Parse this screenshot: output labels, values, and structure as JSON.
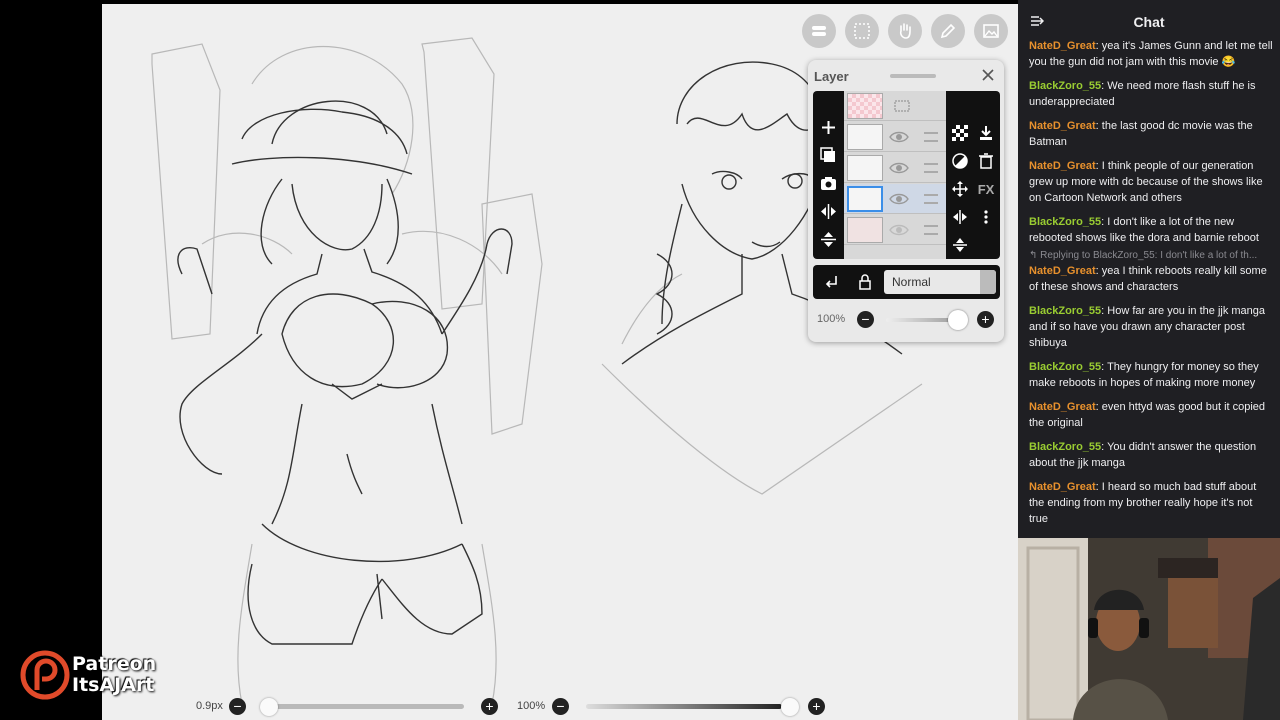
{
  "top_tools": [
    {
      "name": "toggle-tool",
      "icon": "toggle-icon"
    },
    {
      "name": "selection-tool",
      "icon": "selection-icon"
    },
    {
      "name": "hand-tool",
      "icon": "hand-icon"
    },
    {
      "name": "pen-tool",
      "icon": "pen-icon"
    },
    {
      "name": "image-tool",
      "icon": "image-icon"
    }
  ],
  "layer_panel": {
    "title": "Layer",
    "blend_mode": "Normal",
    "opacity": "100%"
  },
  "bottom_bar": {
    "brush_size": "0.9px",
    "brush_opacity": "100%"
  },
  "patreon": {
    "line1": "Patreon",
    "line2": "ItsAJArt"
  },
  "chat": {
    "title": "Chat",
    "user_colors": {
      "NateD_Great": "#e8912d",
      "BlackZoro_55": "#9acd32"
    },
    "messages": [
      {
        "user": "NateD_Great",
        "text": "yea it's James Gunn and let me tell you the gun did not jam with this movie 😂"
      },
      {
        "user": "BlackZoro_55",
        "text": "We need more flash stuff he is underappreciated"
      },
      {
        "user": "NateD_Great",
        "text": "the last good dc movie was the Batman"
      },
      {
        "user": "NateD_Great",
        "text": "I think people of our generation grew up more with dc because of the shows like on Cartoon Network and others"
      },
      {
        "user": "BlackZoro_55",
        "text": "I don't like a lot of the new rebooted shows like the dora and barnie reboot"
      },
      {
        "user": "NateD_Great",
        "reply": "↰ Replying to BlackZoro_55: I don't like a lot of th...",
        "text": "yea I think reboots really kill some of these shows and characters"
      },
      {
        "user": "BlackZoro_55",
        "text": "How far are you in the jjk manga and if so have you drawn any character post shibuya"
      },
      {
        "user": "BlackZoro_55",
        "text": "They hungry for money so they make reboots in hopes of making more money"
      },
      {
        "user": "NateD_Great",
        "text": "even httyd was good but it copied the original"
      },
      {
        "user": "BlackZoro_55",
        "text": "You didn't answer the question about the jjk manga"
      },
      {
        "user": "NateD_Great",
        "text": "I heard so much bad stuff about the ending from my brother really hope it's not true"
      }
    ]
  }
}
